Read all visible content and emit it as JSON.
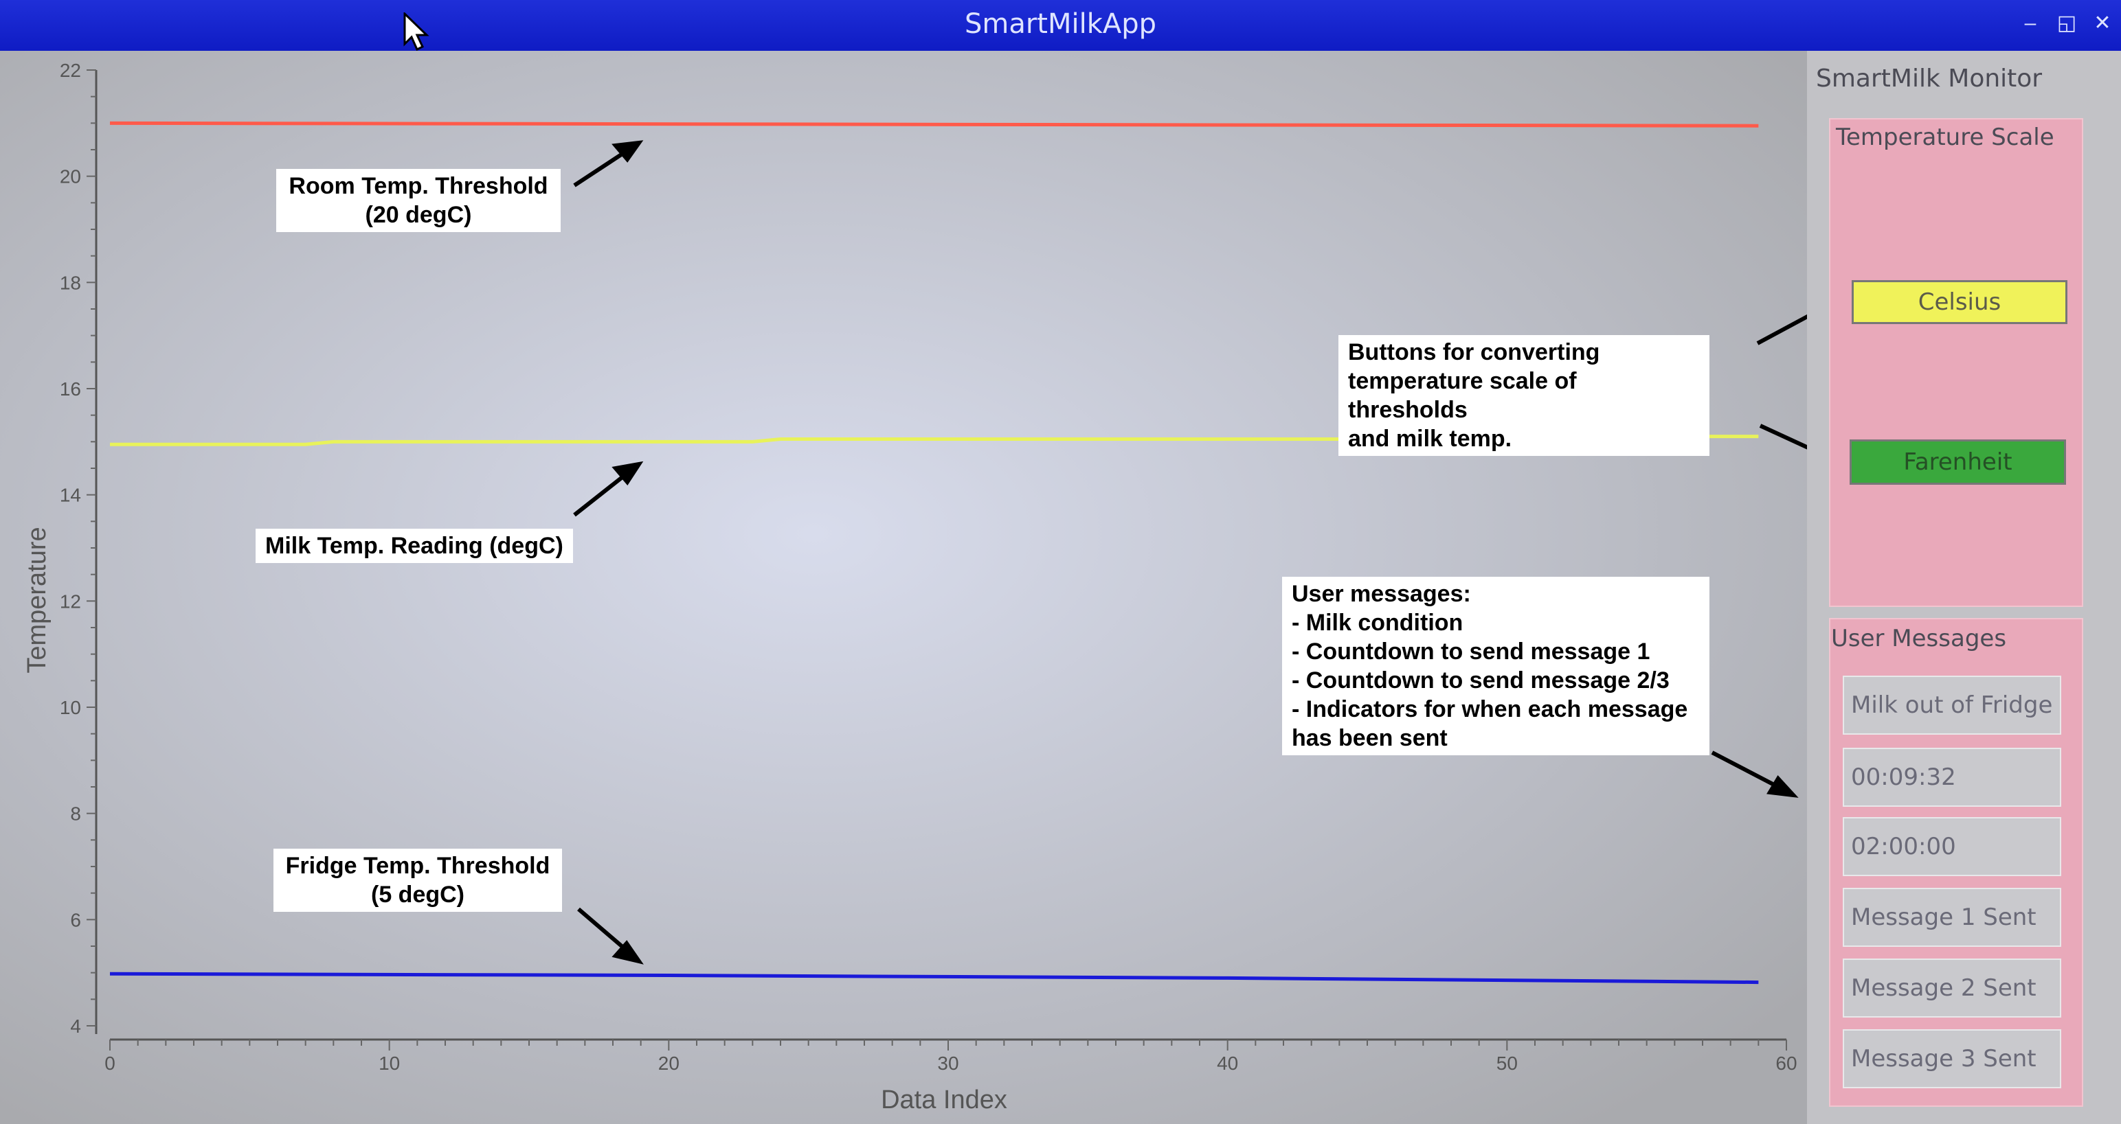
{
  "window": {
    "title": "SmartMilkApp",
    "controls": [
      "–",
      "◱",
      "✕"
    ]
  },
  "chart_data": {
    "type": "line",
    "xlabel": "Data Index",
    "ylabel": "Temperature",
    "xlim": [
      0,
      60
    ],
    "ylim": [
      4,
      22
    ],
    "xticks": [
      0,
      10,
      20,
      30,
      40,
      50,
      60
    ],
    "yticks": [
      4,
      6,
      8,
      10,
      12,
      14,
      16,
      18,
      20,
      22
    ],
    "series": [
      {
        "color": "#ff5a4a",
        "x": [
          0,
          59
        ],
        "y": [
          21.0,
          20.95
        ]
      },
      {
        "color": "#e8f25a",
        "x": [
          0,
          7,
          8,
          23,
          24,
          44,
          45,
          59
        ],
        "y": [
          14.95,
          14.95,
          15.0,
          15.0,
          15.05,
          15.05,
          15.1,
          15.1
        ]
      },
      {
        "color": "#1a1ad8",
        "x": [
          0,
          20,
          40,
          59
        ],
        "y": [
          4.98,
          4.95,
          4.9,
          4.82
        ]
      }
    ]
  },
  "annotations": {
    "room_threshold": "Room Temp. Threshold\n(20 degC)",
    "milk_reading": "Milk Temp. Reading (degC)",
    "fridge_threshold": "Fridge Temp. Threshold\n(5 degC)",
    "buttons_note": "Buttons for converting\ntemperature scale of thresholds\nand milk temp.",
    "messages_note": "User messages:\n- Milk condition\n- Countdown to send message 1\n- Countdown to send message 2/3\n- Indicators for when each message\nhas been sent"
  },
  "sidebar": {
    "title": "SmartMilk Monitor",
    "scale_title": "Temperature Scale",
    "celsius_label": "Celsius",
    "farenheit_label": "Farenheit",
    "messages_title": "User Messages",
    "messages": [
      "Milk out of Fridge",
      "00:09:32",
      "02:00:00",
      "Message 1 Sent",
      "Message 2 Sent",
      "Message 3 Sent"
    ]
  },
  "colors": {
    "titlebar": "#1424cc",
    "room_line": "#ff5a4a",
    "milk_line": "#e8f25a",
    "fridge_line": "#1a1ad8",
    "celsius_button": "#f0f25a",
    "farenheit_button": "#3aa83d",
    "panel_pink": "#e9a9ba"
  }
}
